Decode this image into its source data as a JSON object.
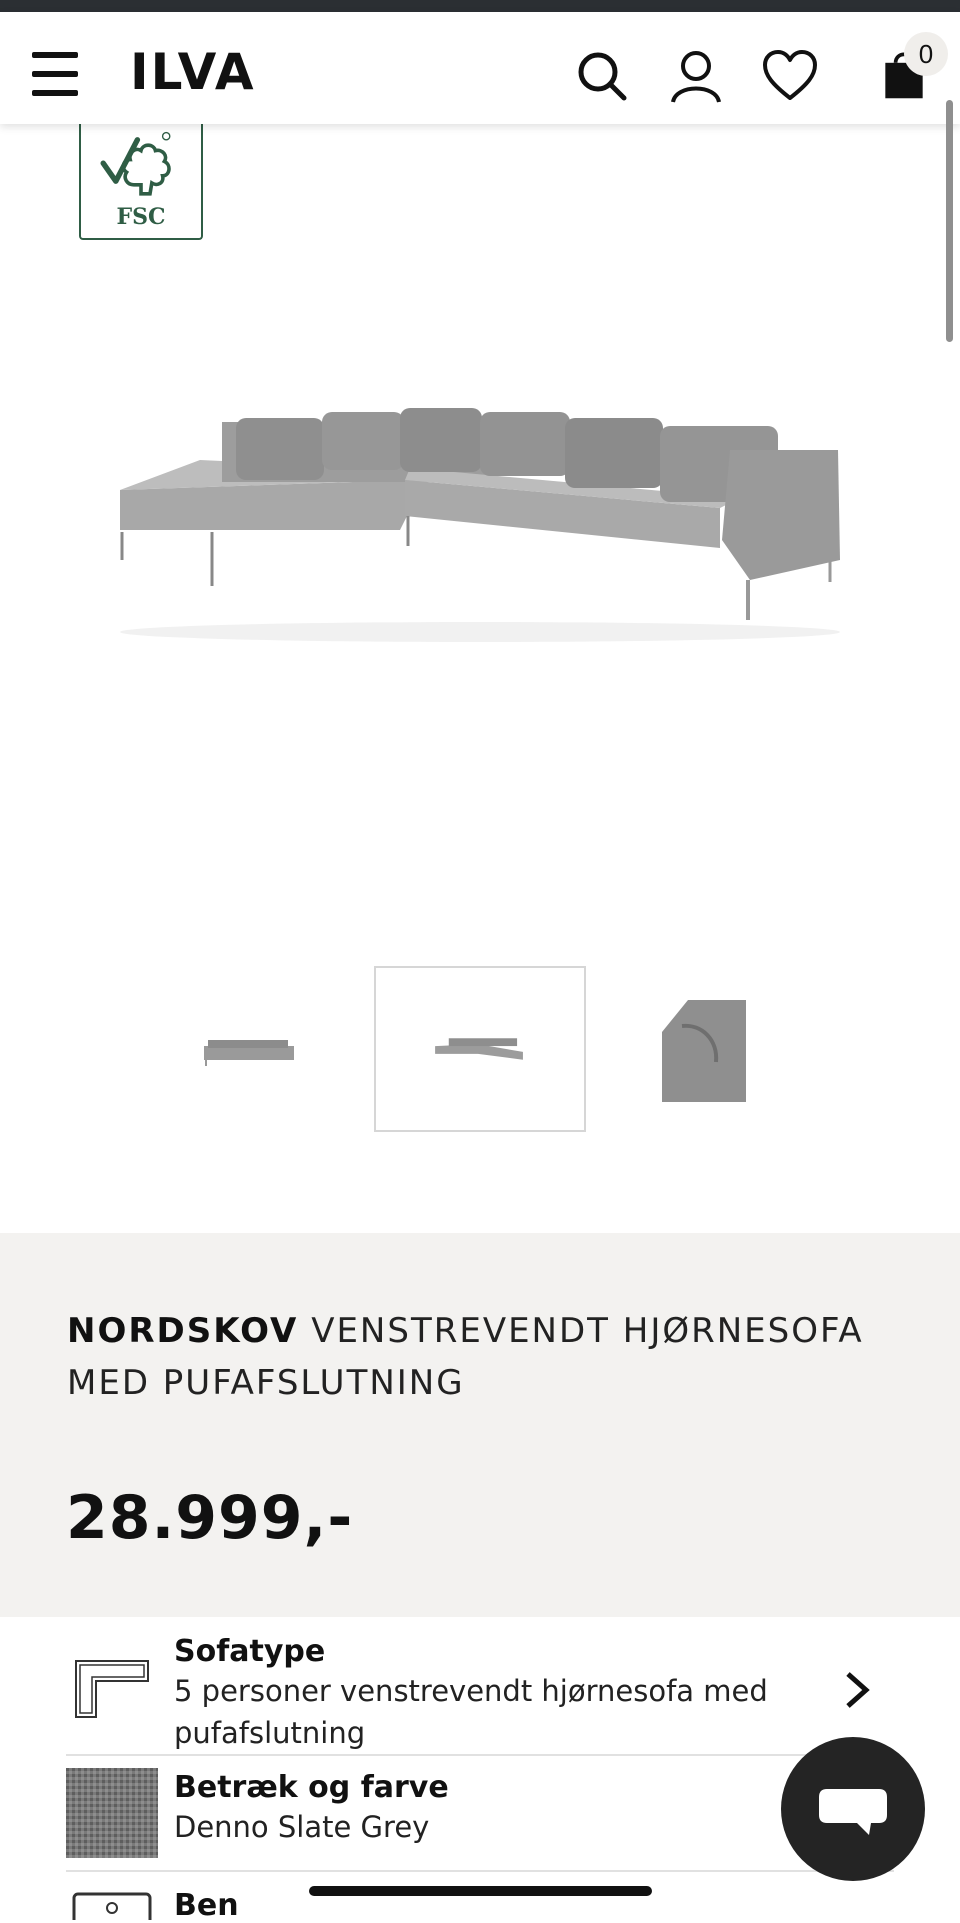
{
  "header": {
    "logo": "ILVA",
    "cart_count": "0",
    "icons": [
      "menu-icon",
      "search-icon",
      "account-icon",
      "heart-icon",
      "bag-icon"
    ]
  },
  "certification": {
    "label": "FSC"
  },
  "gallery": {
    "thumbnail_count": 3,
    "selected_index": 1
  },
  "product": {
    "brand": "NORDSKOV",
    "name": "VENSTREVENDT HJØRNESOFA MED PUFAFSLUTNING",
    "price": "28.999,-"
  },
  "options": [
    {
      "label": "Sofatype",
      "value": "5 personer venstrevendt hjørnesofa med pufafslutning"
    },
    {
      "label": "Betræk og farve",
      "value": "Denno Slate Grey"
    },
    {
      "label": "Ben",
      "value": ""
    }
  ],
  "colors": {
    "accent_dark": "#242424",
    "info_bg": "#f3f2f0",
    "fsc_green": "#2f5d45"
  }
}
